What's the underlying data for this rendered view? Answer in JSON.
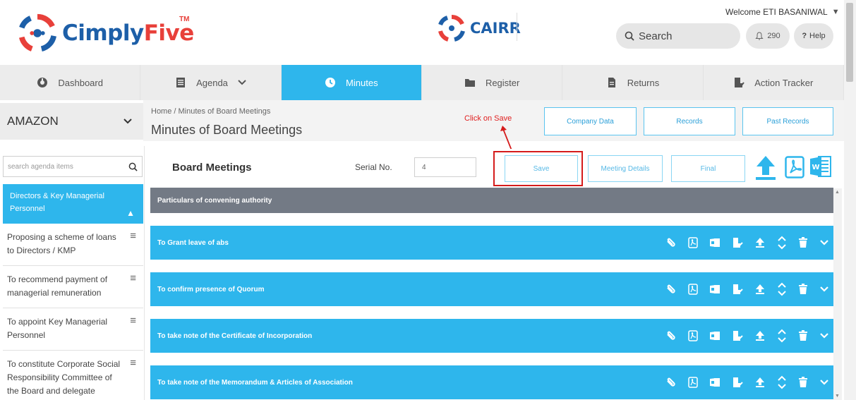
{
  "header": {
    "brand": "CimplyFive",
    "brand_part1": "Cimply",
    "brand_part2": "Five",
    "trademark": "TM",
    "secondary_brand": "CAIRR",
    "welcome": "Welcome ETI BASANIWAL",
    "search_placeholder": "Search",
    "notification_count": "290",
    "help_label": "Help"
  },
  "nav": {
    "items": [
      {
        "label": "Dashboard",
        "icon": "dashboard-icon"
      },
      {
        "label": "Agenda",
        "icon": "agenda-icon"
      },
      {
        "label": "Minutes",
        "icon": "clock-icon",
        "active": true
      },
      {
        "label": "Register",
        "icon": "folder-icon"
      },
      {
        "label": "Returns",
        "icon": "document-icon"
      },
      {
        "label": "Action Tracker",
        "icon": "action-tracker-icon"
      }
    ]
  },
  "subheader": {
    "company": "AMAZON",
    "breadcrumb": "Home  /  Minutes of Board Meetings",
    "title": "Minutes of Board Meetings",
    "annotation": "Click on Save",
    "buttons": [
      "Company Data",
      "Records",
      "Past Records"
    ]
  },
  "sidebar": {
    "search_placeholder": "search agenda items",
    "active_item": "Directors & Key Managerial Personnel",
    "items": [
      "Proposing a scheme of loans to Directors / KMP",
      "To recommend payment of managerial remuneration",
      "To appoint Key Managerial Personnel",
      "To constitute Corporate Social Responsibility Committee of the Board and delegate"
    ]
  },
  "main": {
    "title": "Board Meetings",
    "serial_label": "Serial No.",
    "serial_value": "4",
    "buttons": [
      "Save",
      "Meeting Details",
      "Final"
    ],
    "particulars": "Particulars of convening authority",
    "agenda_items": [
      "To Grant leave of abs",
      "To confirm presence of Quorum",
      "To take note of the Certificate of Incorporation",
      "To take note of the Memorandum & Articles of Association"
    ]
  },
  "colors": {
    "accent": "#2eb6ec",
    "brand_blue": "#1d5fa8",
    "brand_red": "#e8403a",
    "annotation_red": "#d51c1c",
    "particulars_bg": "#737a85"
  }
}
